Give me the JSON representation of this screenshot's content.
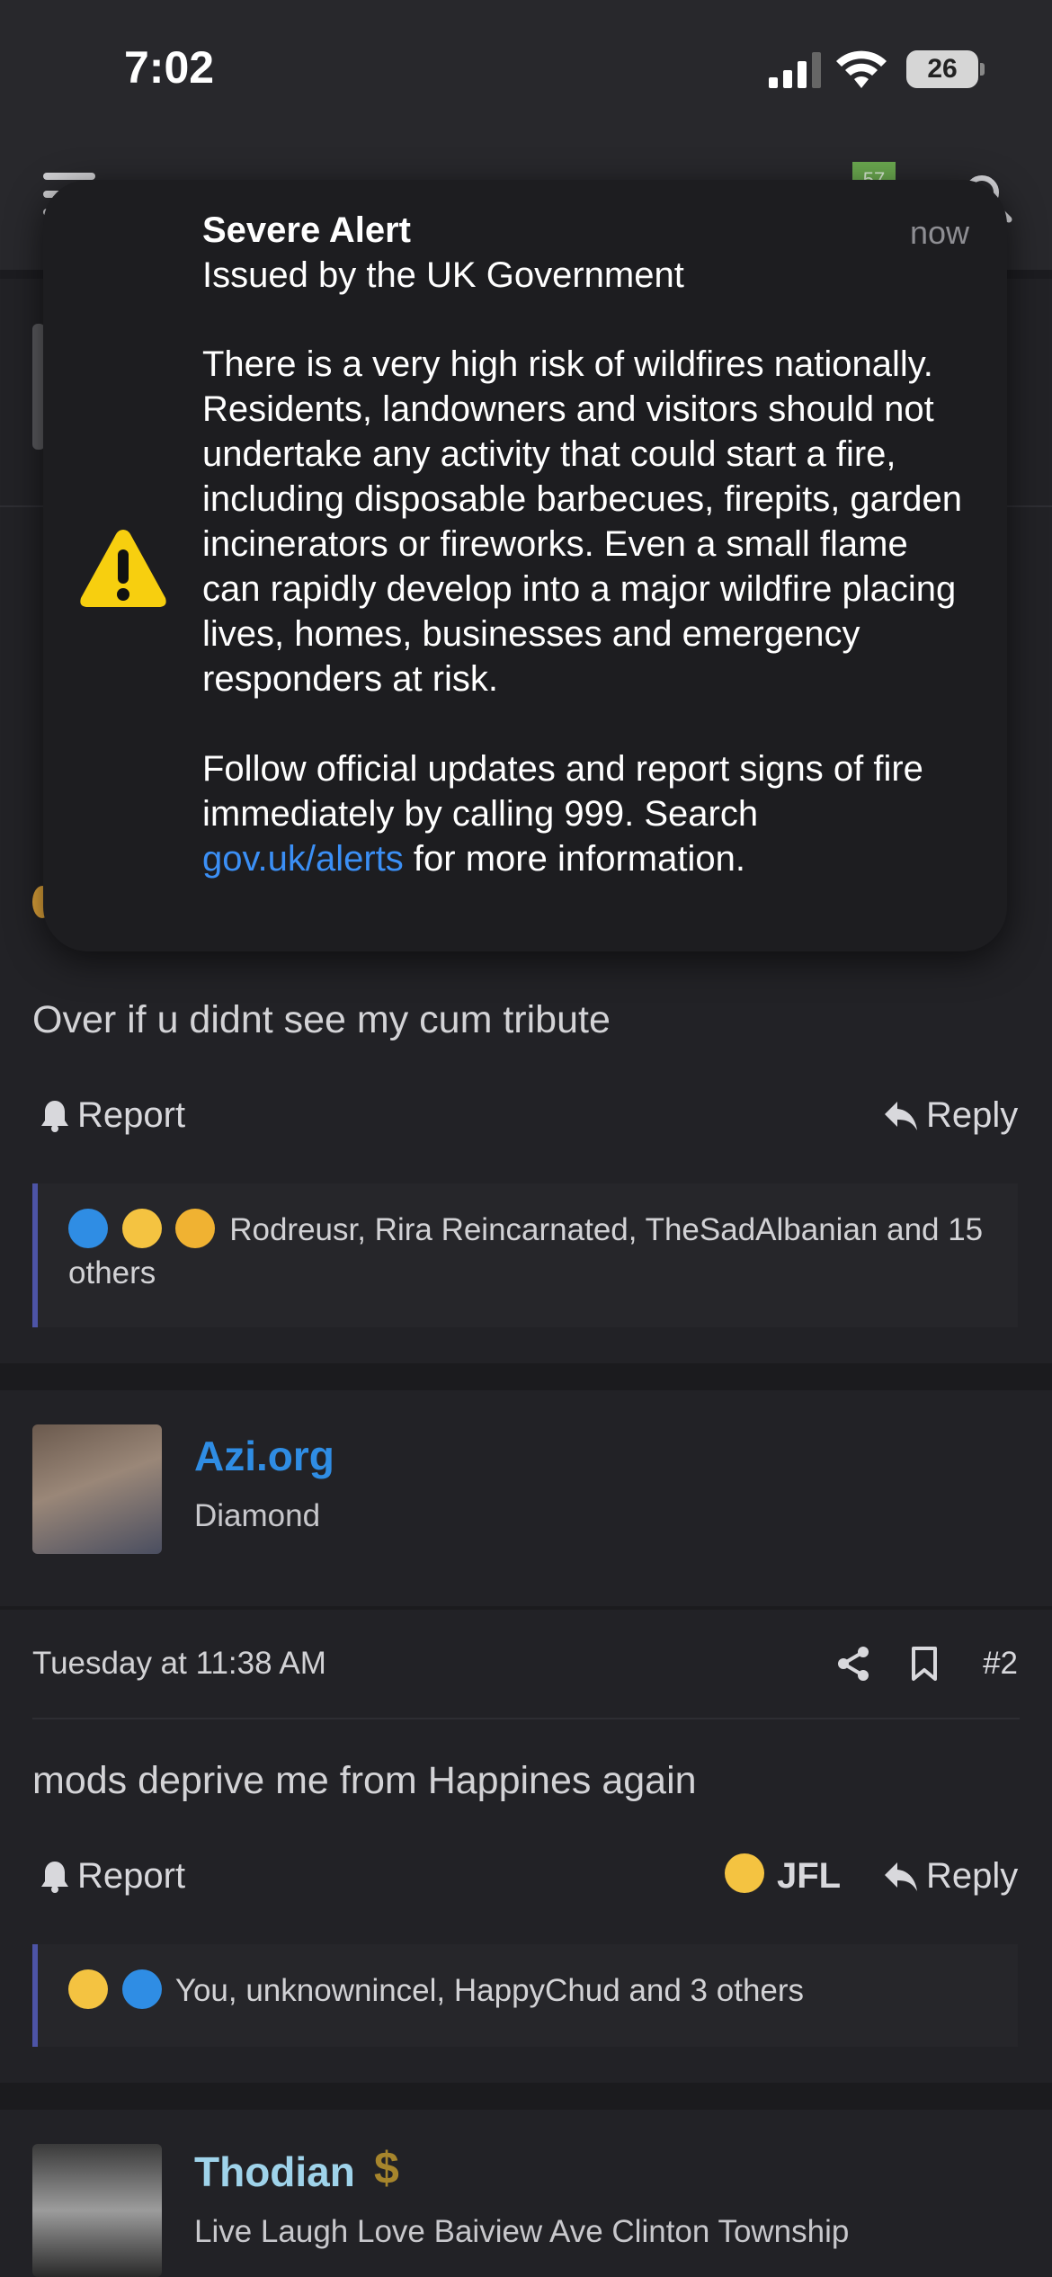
{
  "status_bar": {
    "time": "7:02",
    "battery": "26"
  },
  "app_header": {
    "badge": "57"
  },
  "alert": {
    "title": "Severe Alert",
    "time": "now",
    "subtitle": "Issued by the UK Government",
    "paragraph1": "There is a very high risk of wildfires nationally. Residents, landowners and visitors should not undertake any activity that could start a fire, including disposable barbecues, firepits, garden incinerators or fireworks. Even a small flame can rapidly develop into a major wildfire placing lives, homes, businesses and emergency responders at risk.",
    "paragraph2_start": "Follow official updates and report signs of fire immediately by calling 999. Search ",
    "link": "gov.uk/alerts",
    "paragraph2_end": " for more information."
  },
  "post1": {
    "text": "Over if u didnt see my cum tribute",
    "report_label": "Report",
    "reply_label": "Reply",
    "reactions_text": "Rodreusr, Rira Reincarnated, TheSadAlbanian and 15 others"
  },
  "post2": {
    "username": "Azi.org",
    "user_title": "Diamond",
    "timestamp": "Tuesday at 11:38 AM",
    "post_number": "#2",
    "text": "mods deprive me from Happines again",
    "report_label": "Report",
    "jfl_label": "JFL",
    "reply_label": "Reply",
    "reactions_text": "You, unknownincel, HappyChud and 3 others"
  },
  "post3": {
    "username": "Thodian",
    "user_title": "Live Laugh Love Baiview Ave Clinton Township"
  },
  "colors": {
    "background": "#222226",
    "link_blue": "#3b8ff5",
    "username_blue": "#2f8de4",
    "username_light_blue": "#9fd3ea",
    "reaction_border": "#4d54a6",
    "alert_yellow": "#f7cf0f"
  }
}
